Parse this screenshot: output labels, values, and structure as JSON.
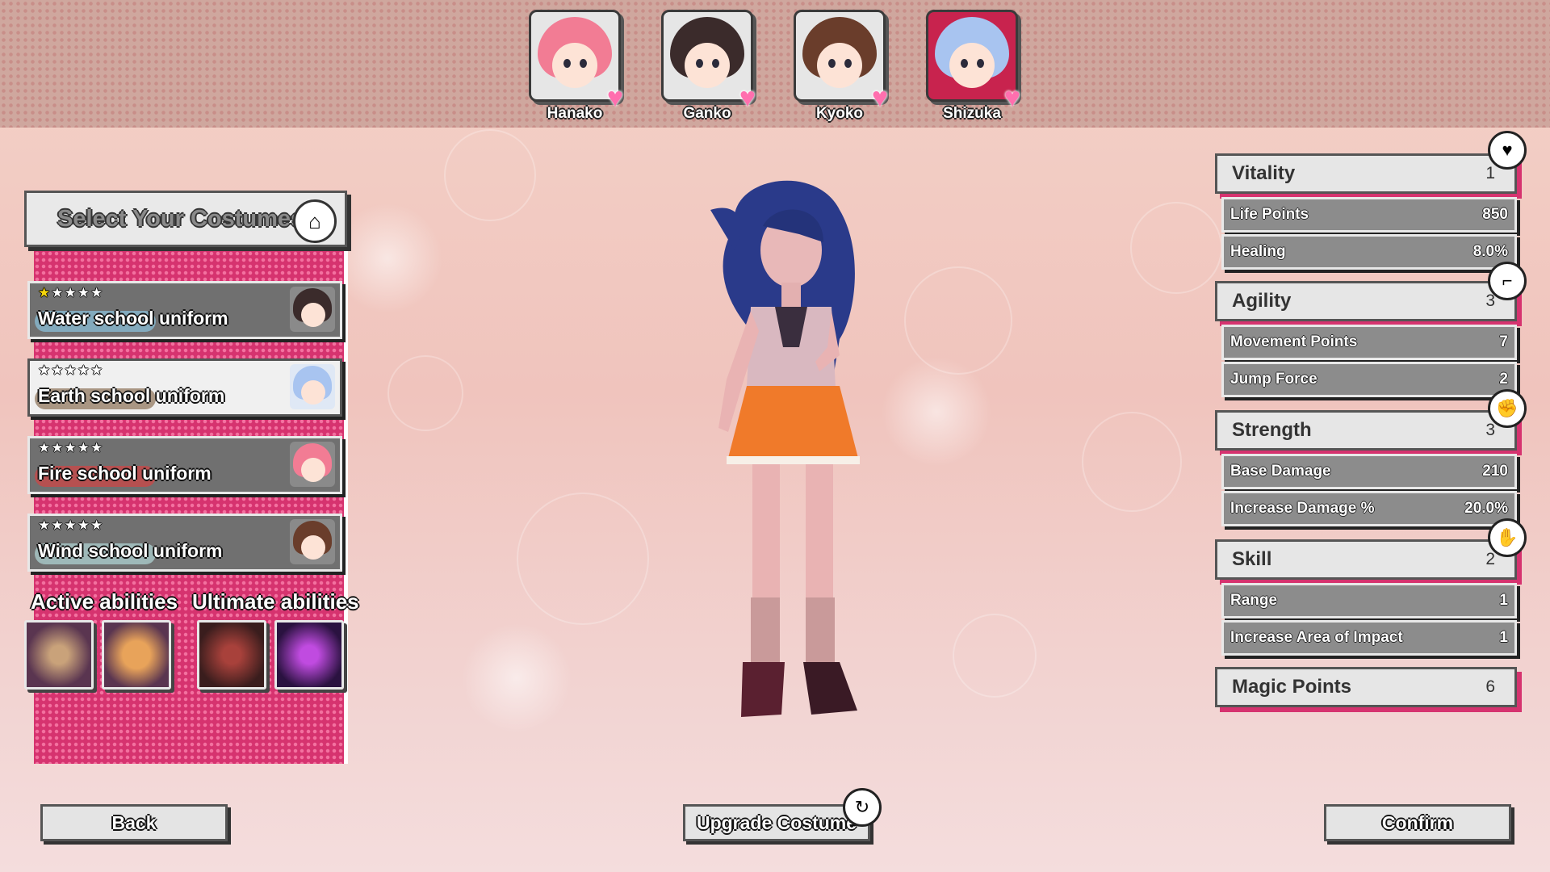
{
  "characters": [
    {
      "name": "Hanako",
      "hair": "#f27c94",
      "bg": "#e6e6e6"
    },
    {
      "name": "Ganko",
      "hair": "#3b2b2b",
      "bg": "#e6e6e6"
    },
    {
      "name": "Kyoko",
      "hair": "#6a3d2b",
      "bg": "#e6e6e6"
    },
    {
      "name": "Shizuka",
      "hair": "#a8c4f0",
      "bg": "#c8234e"
    }
  ],
  "costume_panel": {
    "title": "Select Your Costumes",
    "costumes": [
      {
        "name": "Water school uniform",
        "stars": 1,
        "selected": false,
        "portrait_hair": "#3b2b2b",
        "swoosh": "#8fd0f0"
      },
      {
        "name": "Earth school uniform",
        "stars": 0,
        "selected": true,
        "portrait_hair": "#a8c4f0",
        "swoosh": "#7a5a3a"
      },
      {
        "name": "Fire school uniform",
        "stars": 0,
        "selected": false,
        "portrait_hair": "#f27c94",
        "swoosh": "#e43b3b"
      },
      {
        "name": "Wind school uniform",
        "stars": 0,
        "selected": false,
        "portrait_hair": "#6a3d2b",
        "swoosh": "#bde8e8"
      }
    ],
    "active_label": "Active abilities",
    "ultimate_label": "Ultimate abilities"
  },
  "stats": {
    "vitality": {
      "label": "Vitality",
      "value": "1",
      "rows": [
        {
          "label": "Life Points",
          "value": "850"
        },
        {
          "label": "Healing",
          "value": "8.0%"
        }
      ]
    },
    "agility": {
      "label": "Agility",
      "value": "3",
      "rows": [
        {
          "label": "Movement Points",
          "value": "7"
        },
        {
          "label": "Jump Force",
          "value": "2"
        }
      ]
    },
    "strength": {
      "label": "Strength",
      "value": "3",
      "rows": [
        {
          "label": "Base Damage",
          "value": "210"
        },
        {
          "label": "Increase Damage %",
          "value": "20.0%"
        }
      ]
    },
    "skill": {
      "label": "Skill",
      "value": "2",
      "rows": [
        {
          "label": "Range",
          "value": "1"
        },
        {
          "label": "Increase Area of Impact",
          "value": "1"
        }
      ]
    },
    "magic": {
      "label": "Magic Points",
      "value": "6"
    }
  },
  "buttons": {
    "back": "Back",
    "upgrade": "Upgrade Costume",
    "confirm": "Confirm"
  },
  "icons": {
    "costume": "hanger-icon",
    "vitality": "heart-plus-icon",
    "agility": "boot-icon",
    "strength": "fist-icon",
    "skill": "glove-icon",
    "upgrade": "upgrade-arrow-icon"
  }
}
